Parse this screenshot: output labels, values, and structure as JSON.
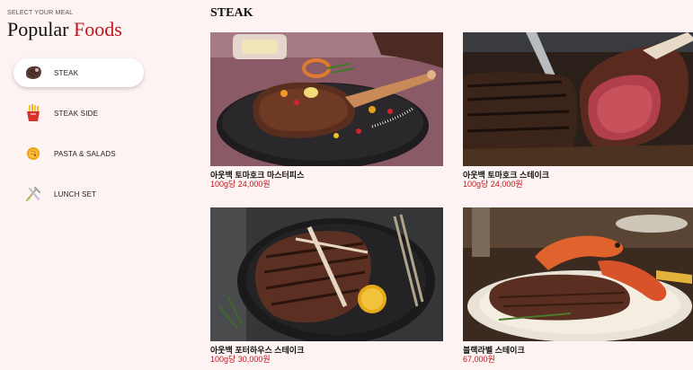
{
  "sidebar": {
    "eyebrow": "SELECT YOUR MEAL",
    "title_main": "Popular",
    "title_accent": "Foods",
    "items": [
      {
        "label": "STEAK",
        "icon": "steak-icon",
        "active": true
      },
      {
        "label": "STEAK SIDE",
        "icon": "fries-icon",
        "active": false
      },
      {
        "label": "PASTA & SALADS",
        "icon": "pasta-icon",
        "active": false
      },
      {
        "label": "LUNCH SET",
        "icon": "utensils-icon",
        "active": false
      }
    ]
  },
  "main": {
    "section_title": "STEAK",
    "products": [
      {
        "name": "아웃백 토마호크 마스터피스",
        "price": "100g당 24,000원",
        "image": "tomahawk-steak-plate-photo"
      },
      {
        "name": "아웃백 토마호크 스테이크",
        "price": "100g당 24,000원",
        "image": "tomahawk-steak-sliced-photo"
      },
      {
        "name": "아웃백 포터하우스 스테이크",
        "price": "100g당 30,000원",
        "image": "porterhouse-steak-photo"
      },
      {
        "name": "블랙라벨 스테이크",
        "price": "67,000원",
        "image": "black-label-steak-shrimp-photo"
      }
    ]
  },
  "colors": {
    "accent": "#c0161d",
    "background": "#fdf3f3"
  }
}
